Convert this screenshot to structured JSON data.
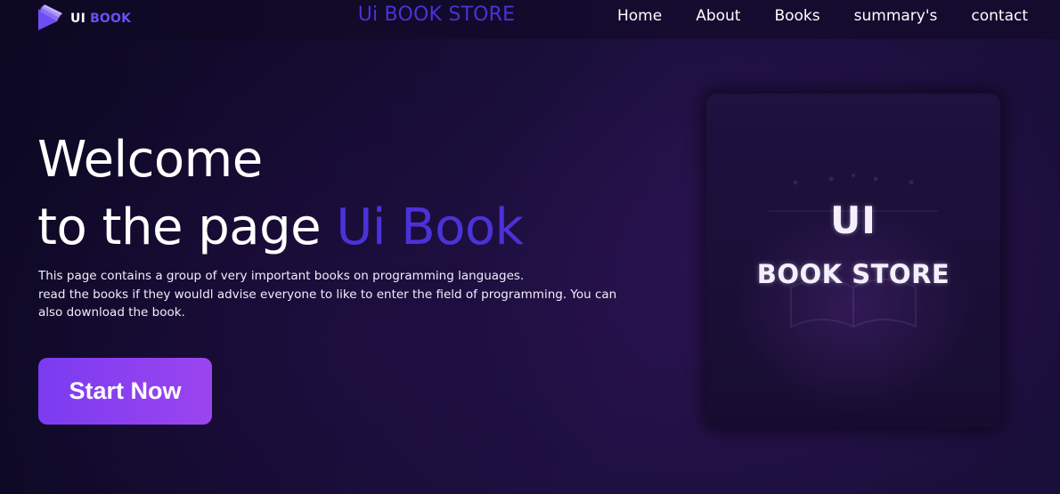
{
  "header": {
    "logo": {
      "icon": "book-logo-icon",
      "text_ui": "UI",
      "text_book": "BOOK"
    },
    "site_title": "Ui BOOK STORE",
    "nav": [
      {
        "label": "Home"
      },
      {
        "label": "About"
      },
      {
        "label": "Books"
      },
      {
        "label": "summary's"
      },
      {
        "label": "contact"
      }
    ]
  },
  "hero": {
    "title_line1": "Welcome",
    "title_line2_prefix": "to the page ",
    "title_line2_accent": "Ui Book",
    "description_line1": "This page contains a group of very important books on programming languages.",
    "description_line2": "read the books if they wouldl advise everyone to like to enter the field of programming. You can also download the book.",
    "cta_label": "Start Now"
  },
  "book_card": {
    "line1": "UI",
    "line2": "BOOK STORE",
    "decor_icon": "open-book-icon"
  },
  "colors": {
    "accent": "#4b32d8",
    "logo_book": "#6d4ef5",
    "button_start": "#7b3bf0",
    "button_end": "#9b45ef",
    "background": "#150c32"
  }
}
